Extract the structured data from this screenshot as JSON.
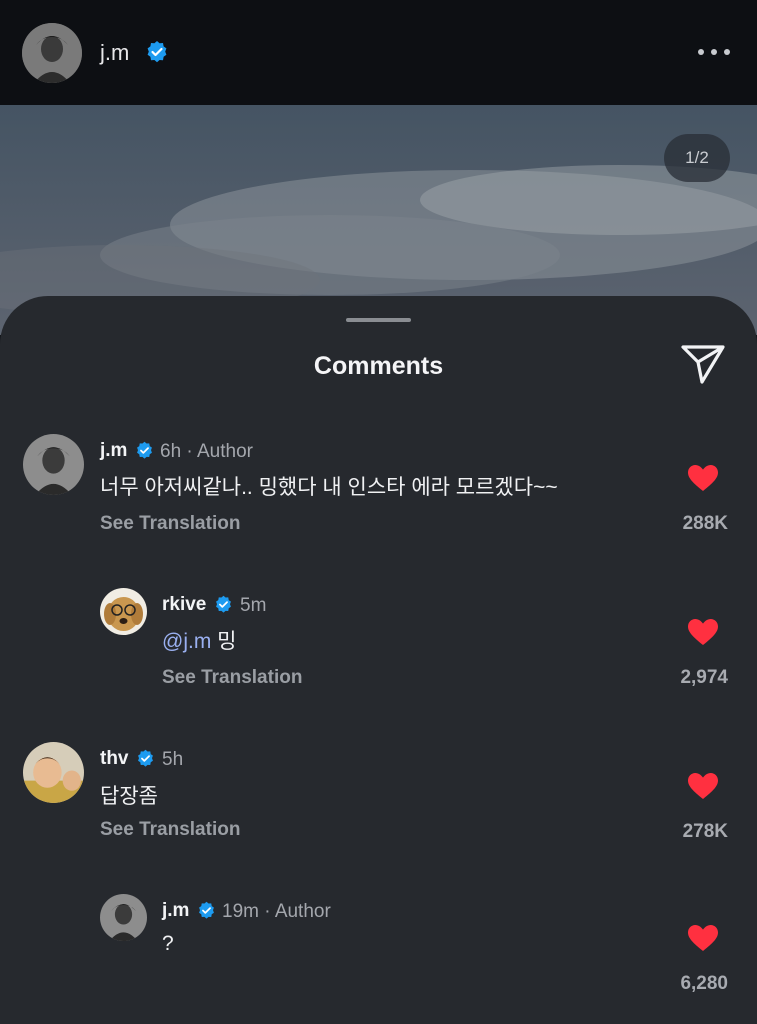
{
  "header": {
    "username": "j.m"
  },
  "post": {
    "page_indicator": "1/2"
  },
  "sheet": {
    "title": "Comments"
  },
  "comments": [
    {
      "username": "j.m",
      "time": "6h",
      "role": "Author",
      "text": "너무 아저씨같나.. 밍했다 내 인스타 에라 모르겠다~~",
      "see_translation": "See Translation",
      "likes": "288K"
    },
    {
      "username": "rkive",
      "time": "5m",
      "mention": "@j.m",
      "text": "밍",
      "see_translation": "See Translation",
      "likes": "2,974"
    },
    {
      "username": "thv",
      "time": "5h",
      "text": "답장좀",
      "see_translation": "See Translation",
      "likes": "278K"
    },
    {
      "username": "j.m",
      "time": "19m",
      "role": "Author",
      "text": "?",
      "likes": "6,280"
    }
  ],
  "colors": {
    "heart": "#ff3040",
    "verified": "#1d9bf0",
    "mention": "#9ab0f0"
  },
  "icons": [
    "verified-badge-icon",
    "more-options-icon",
    "share-send-icon",
    "heart-icon"
  ]
}
